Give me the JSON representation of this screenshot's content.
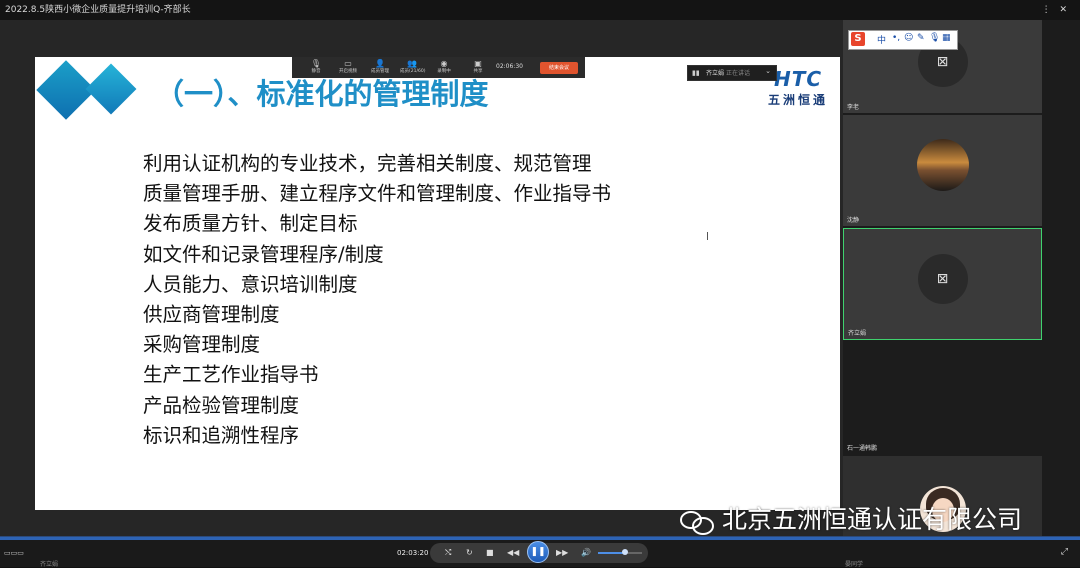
{
  "window": {
    "title": "2022.8.5陕西小微企业质量提升培训Q-齐部长",
    "controls": "⋮ ✕"
  },
  "meeting_toolbar": {
    "items": [
      {
        "icon": "mic-icon",
        "glyph": "🎙",
        "label": "静音"
      },
      {
        "icon": "camera-icon",
        "glyph": "▭",
        "label": "开启视频"
      },
      {
        "icon": "participants-icon",
        "glyph": "👤",
        "label": "成员管理"
      },
      {
        "icon": "members-icon",
        "glyph": "👥",
        "label": "成员(21/60)"
      },
      {
        "icon": "record-icon",
        "glyph": "◉",
        "label": "录制中"
      },
      {
        "icon": "share-icon",
        "glyph": "▣",
        "label": "共享"
      }
    ],
    "time": "02:06:30",
    "end_label": "结束会议"
  },
  "speaker": {
    "signal": "▮▮",
    "name": "齐立娟",
    "status": "正在讲话"
  },
  "slide": {
    "title": "（一）、标准化的管理制度",
    "brand_en": "HTC",
    "brand_cn": "五洲恒通",
    "lines": [
      "利用认证机构的专业技术，完善相关制度、规范管理",
      "质量管理手册、建立程序文件和管理制度、作业指导书",
      "发布质量方针、制定目标",
      "如文件和记录管理程序/制度",
      "人员能力、意识培训制度",
      "供应商管理制度",
      "采购管理制度",
      "生产工艺作业指导书",
      "产品检验管理制度",
      "标识和追溯性程序"
    ]
  },
  "ime": {
    "logo": "S",
    "buttons": [
      "中",
      "•,",
      "☺",
      "✎",
      "🎙",
      "▦"
    ]
  },
  "participants": [
    {
      "name": "李老",
      "state": "camera-off"
    },
    {
      "name": "沈静",
      "state": "sunset"
    },
    {
      "name": "齐立娟",
      "state": "camera-off",
      "active": true
    },
    {
      "name": "石一通韩鹏",
      "state": "empty"
    },
    {
      "name": "晏同学",
      "state": "avatar"
    }
  ],
  "watermark": "北京五洲恒通认证有限公司",
  "player": {
    "time": "02:03:20",
    "left_icon": "▭▭▭",
    "buttons": [
      "⤭",
      "↻",
      "■",
      "◀◀",
      "▶▶",
      "🔊"
    ],
    "play_glyph": "❚❚",
    "volume": 0.62,
    "fullscreen": "⤢",
    "lower_left": "齐立娟",
    "lower_right": "晏同学"
  }
}
